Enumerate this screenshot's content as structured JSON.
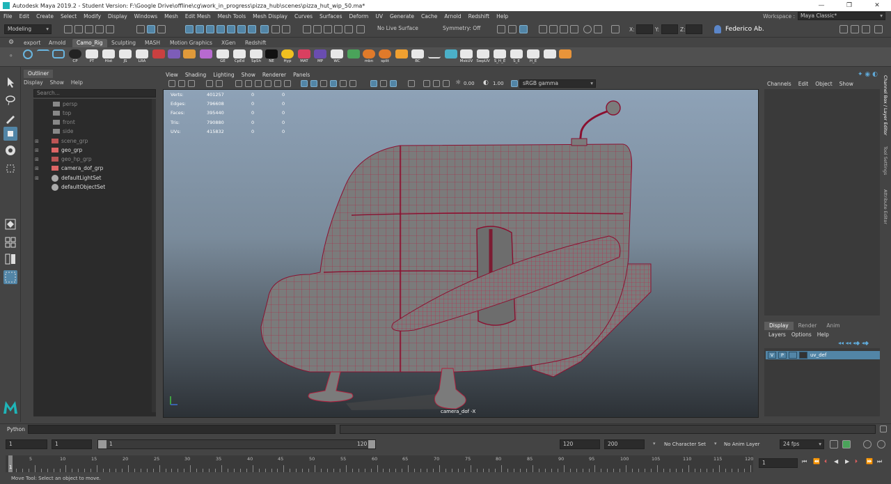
{
  "title": "Autodesk Maya 2019.2 - Student Version: F:\\Google Drive\\offline\\cg\\work_in_progress\\pizza_hub\\scenes\\pizza_hut_wip_50.ma*",
  "menus": [
    "File",
    "Edit",
    "Create",
    "Select",
    "Modify",
    "Display",
    "Windows",
    "Mesh",
    "Edit Mesh",
    "Mesh Tools",
    "Mesh Display",
    "Curves",
    "Surfaces",
    "Deform",
    "UV",
    "Generate",
    "Cache",
    "Arnold",
    "Redshift",
    "Help"
  ],
  "workspace": {
    "label": "Workspace :",
    "value": "Maya Classic*"
  },
  "status": {
    "mode": "Modeling",
    "live_surface": "No Live Surface",
    "symmetry": "Symmetry: Off",
    "x_label": "X:",
    "y_label": "Y:",
    "z_label": "Z:",
    "user": "Federico Ab."
  },
  "shelf_tabs": [
    "export",
    "Arnold",
    "Camo_Rig",
    "Sculpting",
    "MASH",
    "Motion Graphics",
    "XGen",
    "Redshift"
  ],
  "shelf_active": "Camo_Rig",
  "shelf_buttons": [
    "CP",
    "PT",
    "Hist",
    "JS",
    "LRA",
    "",
    "",
    "",
    "GE",
    "CpEd",
    "SpSh",
    "NE",
    "Hyp",
    "MAT",
    "MP",
    "WC",
    "",
    "mbn",
    "split",
    "",
    "BC",
    "",
    "",
    "MskUV",
    "SwpUV",
    "S_H_E",
    "S_E",
    "H_E",
    "",
    ""
  ],
  "outliner": {
    "tab": "Outliner",
    "menu": [
      "Display",
      "Show",
      "Help"
    ],
    "search_placeholder": "Search...",
    "items": [
      {
        "name": "persp",
        "dim": true,
        "expand": false
      },
      {
        "name": "top",
        "dim": true,
        "expand": false
      },
      {
        "name": "front",
        "dim": true,
        "expand": false
      },
      {
        "name": "side",
        "dim": true,
        "expand": false
      },
      {
        "name": "scene_grp",
        "dim": true,
        "expand": true
      },
      {
        "name": "geo_grp",
        "dim": false,
        "expand": true
      },
      {
        "name": "geo_hp_grp",
        "dim": true,
        "expand": true
      },
      {
        "name": "camera_dof_grp",
        "dim": false,
        "expand": true
      },
      {
        "name": "defaultLightSet",
        "dim": false,
        "expand": true
      },
      {
        "name": "defaultObjectSet",
        "dim": false,
        "expand": false
      }
    ]
  },
  "viewport": {
    "menu": [
      "View",
      "Shading",
      "Lighting",
      "Show",
      "Renderer",
      "Panels"
    ],
    "exposure": "0.00",
    "gamma": "1.00",
    "color_space": "sRGB gamma",
    "camera": "camera_dof -X",
    "hud": [
      {
        "label": "Verts:",
        "v1": "401257",
        "v2": "0",
        "v3": "0"
      },
      {
        "label": "Edges:",
        "v1": "796608",
        "v2": "0",
        "v3": "0"
      },
      {
        "label": "Faces:",
        "v1": "395440",
        "v2": "0",
        "v3": "0"
      },
      {
        "label": "Tris:",
        "v1": "790880",
        "v2": "0",
        "v3": "0"
      },
      {
        "label": "UVs:",
        "v1": "415832",
        "v2": "0",
        "v3": "0"
      }
    ]
  },
  "channelbox": {
    "menu": [
      "Channels",
      "Edit",
      "Object",
      "Show"
    ]
  },
  "side_tabs": [
    "Channel Box / Layer Editor",
    "Tool Settings",
    "Attribute Editor"
  ],
  "layers": {
    "tabs": [
      "Display",
      "Render",
      "Anim"
    ],
    "menu": [
      "Layers",
      "Options",
      "Help"
    ],
    "row": {
      "v": "V",
      "p": "P",
      "name": "uv_def"
    }
  },
  "command": {
    "label": "Python"
  },
  "range": {
    "start": "1",
    "start2": "1",
    "slider_start": "1",
    "slider_end": "120",
    "end": "120",
    "end2": "200",
    "character": "No Character Set",
    "anim_layer": "No Anim Layer",
    "fps": "24 fps"
  },
  "timeline": {
    "ticks": [
      "5",
      "10",
      "15",
      "20",
      "25",
      "30",
      "35",
      "40",
      "45",
      "50",
      "55",
      "60",
      "65",
      "70",
      "75",
      "80",
      "85",
      "90",
      "95",
      "100",
      "105",
      "110",
      "115",
      "120"
    ],
    "current_frame": "1",
    "current_frame_field": "1"
  },
  "help_text": "Move Tool: Select an object to move."
}
